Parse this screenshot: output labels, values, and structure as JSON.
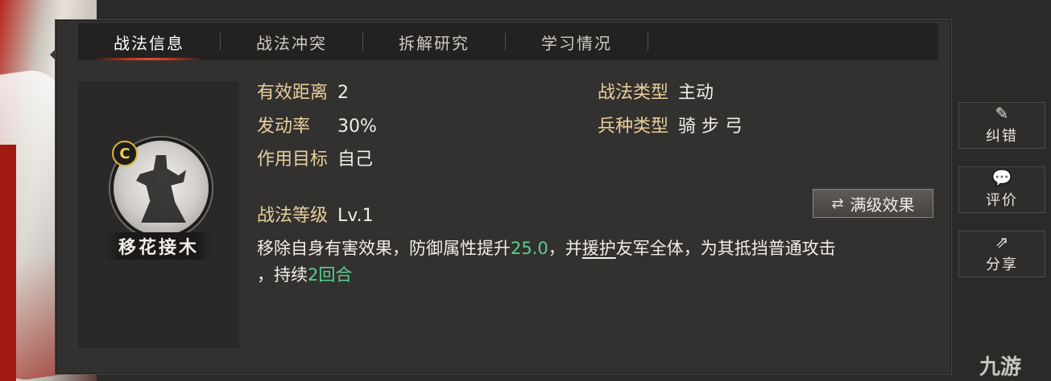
{
  "tabs": [
    "战法信息",
    "战法冲突",
    "拆解研究",
    "学习情况"
  ],
  "skill": {
    "grade": "C",
    "name": "移花接木"
  },
  "stats": {
    "range_label": "有效距离",
    "range_value": "2",
    "rate_label": "发动率",
    "rate_value": "30%",
    "target_label": "作用目标",
    "target_value": "自己",
    "type_label": "战法类型",
    "type_value": "主动",
    "troop_label": "兵种类型",
    "troop_value": "骑 步 弓",
    "level_label": "战法等级",
    "level_value": "Lv.1"
  },
  "full_level_button": "满级效果",
  "description": {
    "part1": "移除自身有害效果，防御属性提升",
    "num1": "25.0",
    "part2": "，并",
    "keyword": "援护",
    "part3": "友军全体，为其抵挡普通攻击",
    "part4": "，持续",
    "num2": "2回合"
  },
  "side_buttons": [
    {
      "label": "纠错",
      "icon": "edit-icon"
    },
    {
      "label": "评价",
      "icon": "comment-icon"
    },
    {
      "label": "分享",
      "icon": "share-icon"
    }
  ],
  "watermark": "九游",
  "colors": {
    "accent_green": "#56d28c",
    "label_gold": "#e6cf9a",
    "tab_red": "#c0331f"
  }
}
